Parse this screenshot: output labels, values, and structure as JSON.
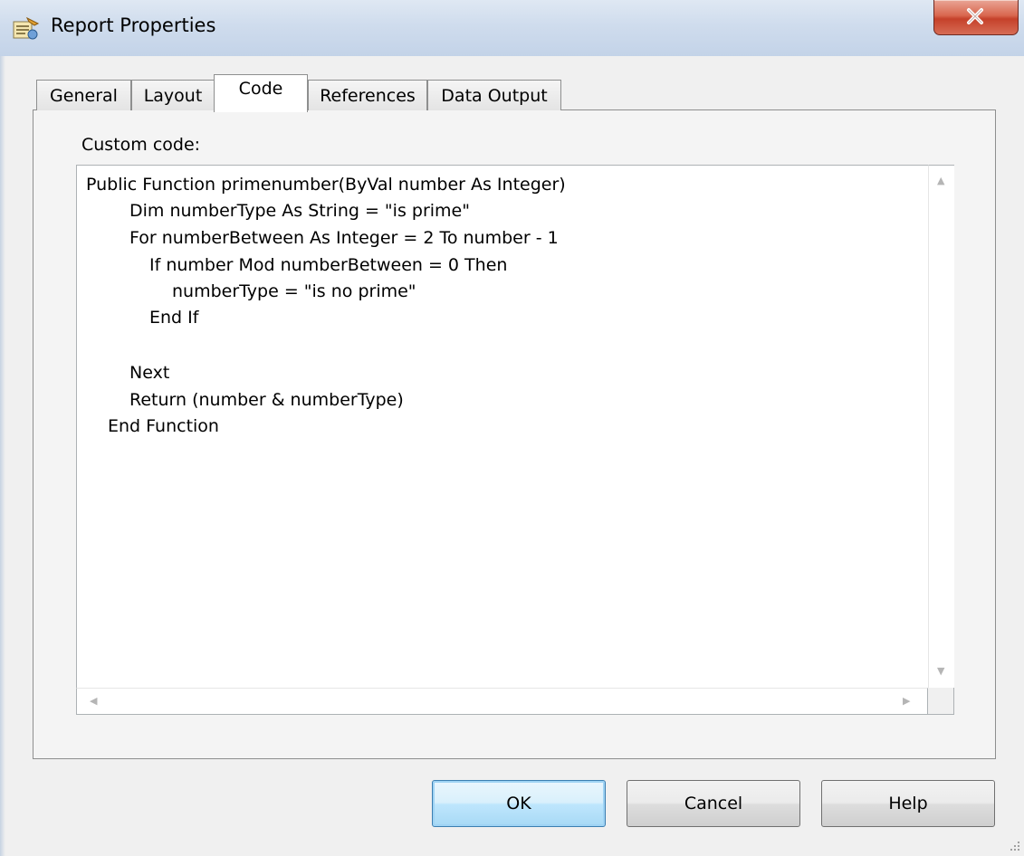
{
  "window": {
    "title": "Report Properties"
  },
  "tabs": [
    {
      "label": "General"
    },
    {
      "label": "Layout"
    },
    {
      "label": "Code"
    },
    {
      "label": "References"
    },
    {
      "label": "Data Output"
    }
  ],
  "active_tab": "Code",
  "code_section": {
    "label": "Custom code:",
    "lines": [
      "Public Function primenumber(ByVal number As Integer)",
      "Dim numberType As String = \"is prime\"",
      "For numberBetween As Integer = 2 To number - 1",
      "If number Mod numberBetween = 0 Then",
      "numberType = \"is no prime\"",
      "End If",
      "",
      "Next",
      "Return (number & numberType)",
      "End Function"
    ]
  },
  "buttons": {
    "ok": "OK",
    "cancel": "Cancel",
    "help": "Help"
  },
  "icons": {
    "title": "report-properties-icon",
    "close": "close-icon"
  },
  "colors": {
    "close_button": "#c5412a",
    "default_button_border": "#3c7fb1",
    "titlebar": "#cfdced"
  }
}
